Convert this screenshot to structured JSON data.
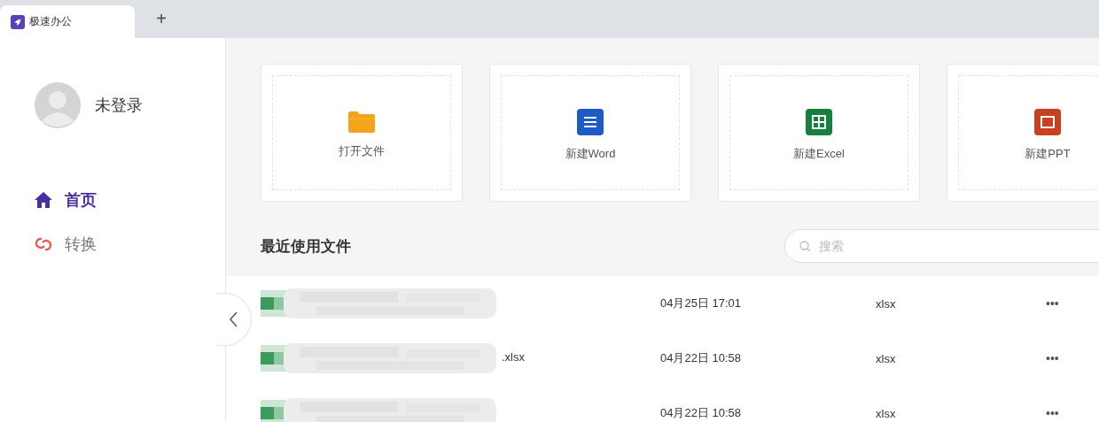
{
  "tabs": [
    {
      "label": "极速办公",
      "selected": true
    }
  ],
  "new_tab": "+",
  "user": {
    "name": "未登录"
  },
  "nav": [
    {
      "label": "首页",
      "kind": "home",
      "selected": true
    },
    {
      "label": "转换",
      "kind": "convert",
      "selected": false
    }
  ],
  "actions": [
    {
      "label": "打开文件",
      "kind": "folder"
    },
    {
      "label": "新建Word",
      "kind": "word"
    },
    {
      "label": "新建Excel",
      "kind": "excel"
    },
    {
      "label": "新建PPT",
      "kind": "ppt"
    }
  ],
  "recent": {
    "title": "最近使用文件",
    "search": {
      "placeholder": "搜索"
    },
    "rows": [
      {
        "name": "",
        "date": "04月25日 17:01",
        "type": "xlsx",
        "more": "•••"
      },
      {
        "name": ".xlsx",
        "date": "04月22日 10:58",
        "type": "xlsx",
        "more": "•••"
      },
      {
        "name": "",
        "date": "04月22日 10:58",
        "type": "xlsx",
        "more": "•••"
      }
    ]
  }
}
